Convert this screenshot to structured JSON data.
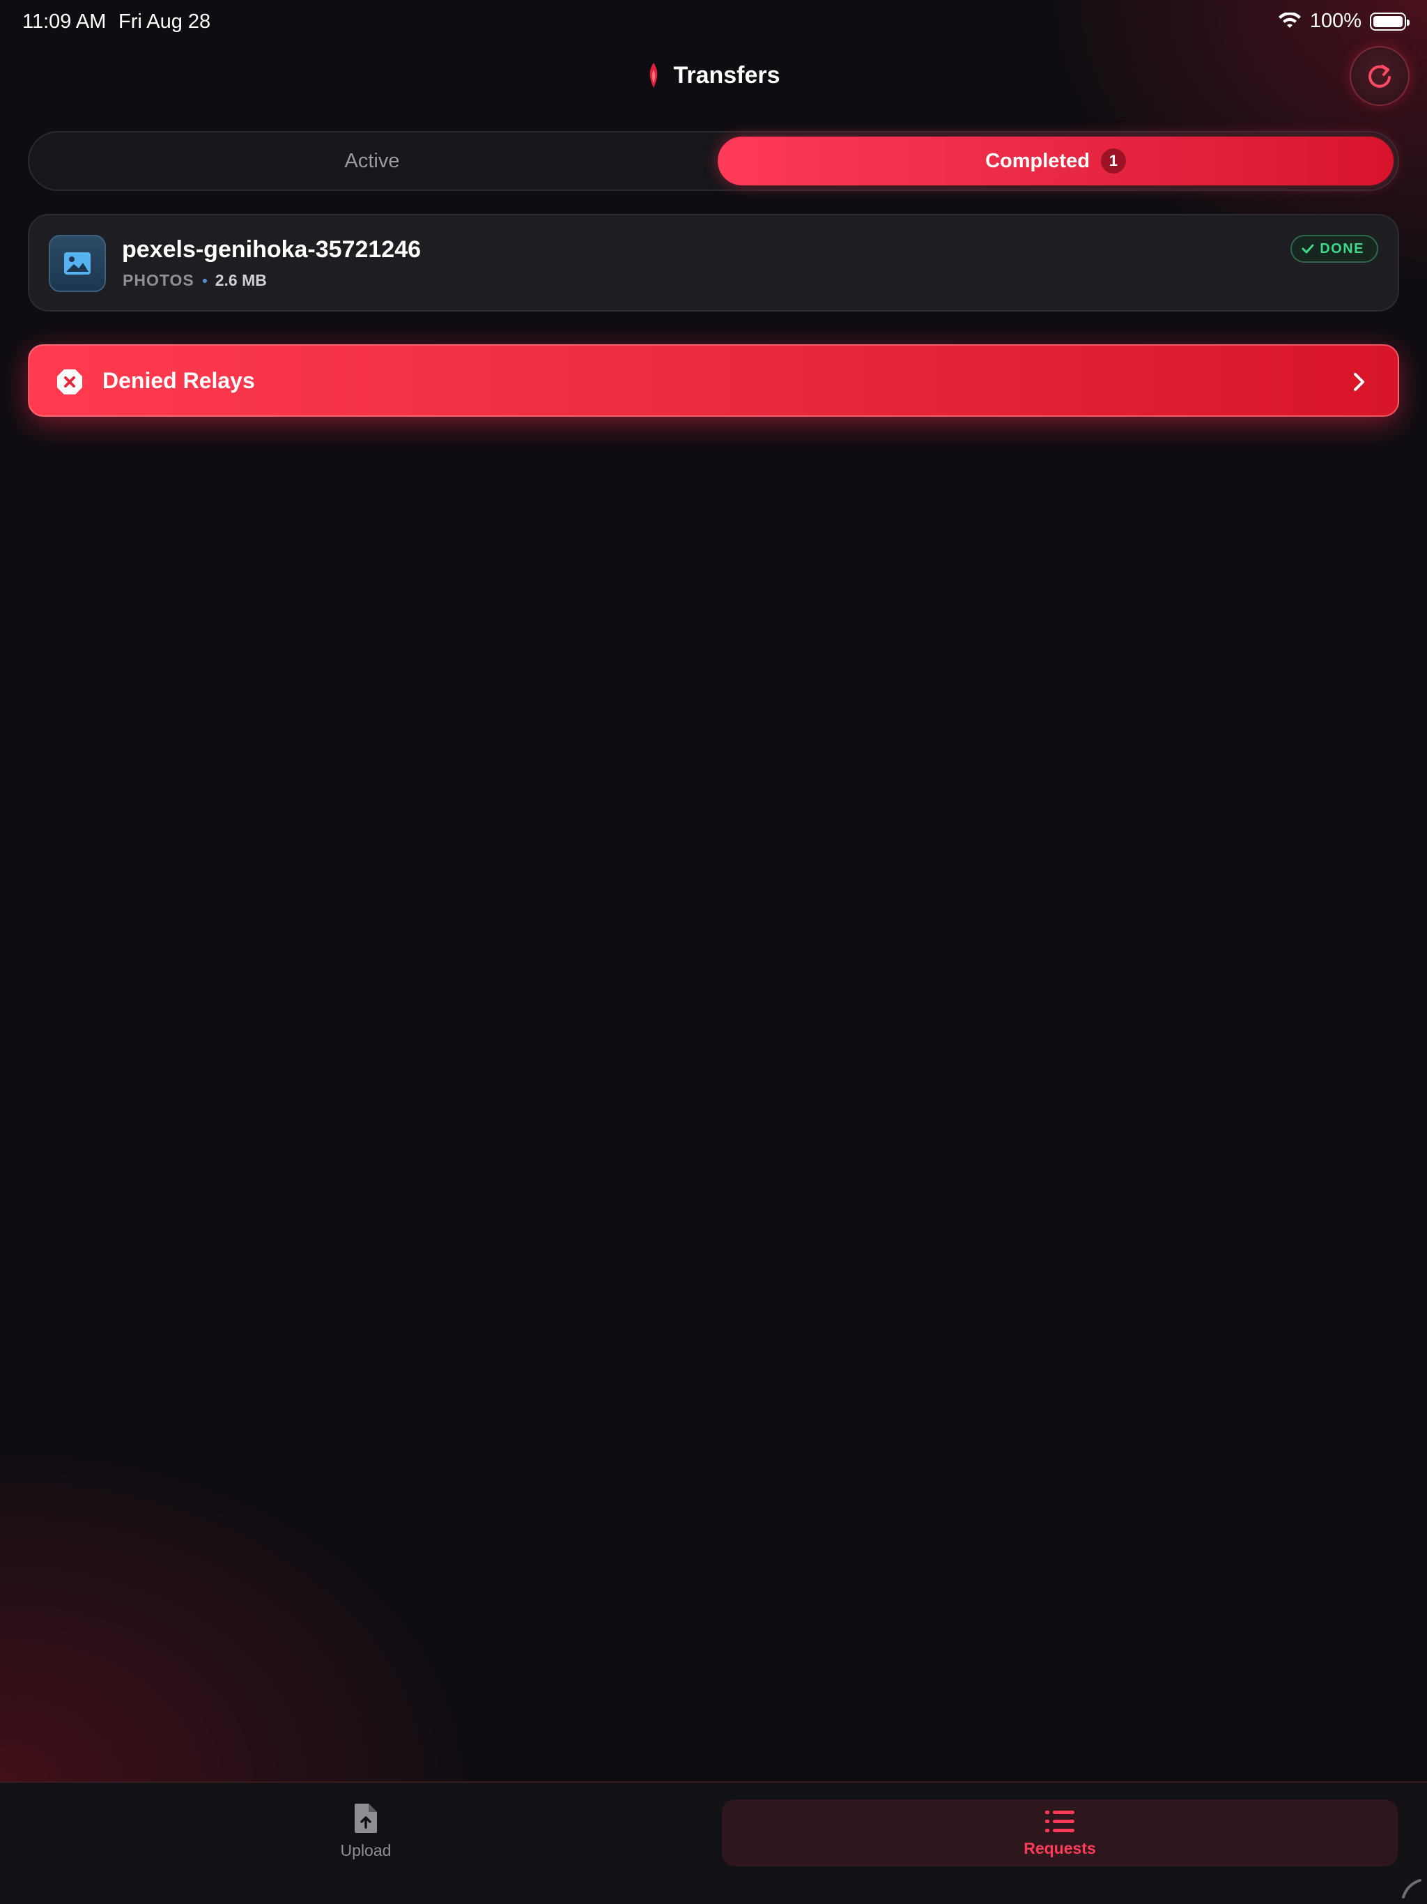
{
  "status_bar": {
    "time": "11:09 AM",
    "date": "Fri Aug 28",
    "battery": "100%",
    "wifi_icon": "wifi-icon",
    "battery_icon": "battery-icon"
  },
  "header": {
    "title": "Transfers",
    "logo_icon": "flame-icon",
    "refresh_icon": "refresh-icon"
  },
  "tabs": {
    "active_label": "Active",
    "completed_label": "Completed",
    "completed_count": "1",
    "selected": "Completed"
  },
  "transfers": [
    {
      "name": "pexels-genihoka-35721246",
      "category": "PHOTOS",
      "size": "2.6 MB",
      "status": "DONE",
      "icon": "image-icon"
    }
  ],
  "denied_relays": {
    "label": "Denied Relays",
    "icon": "x-octagon-icon"
  },
  "tab_bar": {
    "upload_label": "Upload",
    "requests_label": "Requests",
    "selected": "Requests"
  },
  "colors": {
    "accent": "#ff3b57",
    "accent_dark": "#d8142c",
    "background": "#0e0d12",
    "success": "#3fd98a",
    "card": "#1d1d22"
  }
}
